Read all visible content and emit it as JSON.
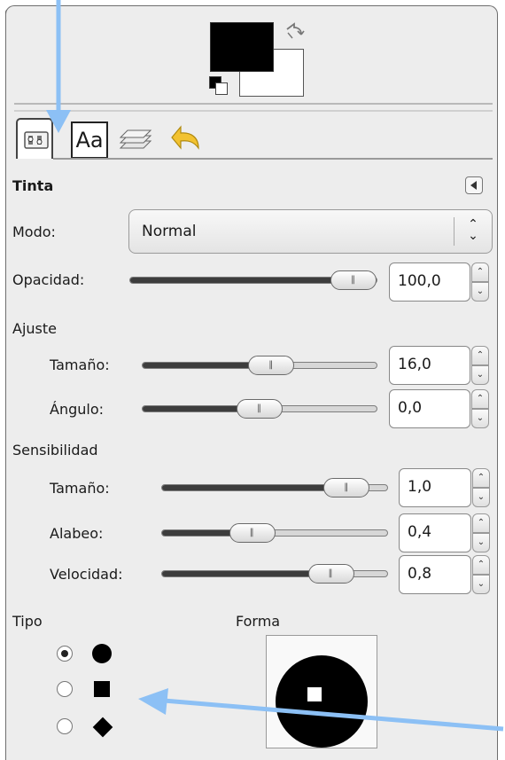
{
  "colors": {
    "accent_arrow": "#8cc0f5",
    "foreground": "#000000",
    "background": "#ffffff"
  },
  "tabs": [
    {
      "icon": "tool-options-icon"
    },
    {
      "label": "Aa"
    },
    {
      "icon": "layers-icon"
    },
    {
      "icon": "undo-history-icon"
    }
  ],
  "panel": {
    "title": "Tinta",
    "mode": {
      "label": "Modo:",
      "value": "Normal"
    },
    "opacity": {
      "label": "Opacidad:",
      "value": "100,0",
      "level": 1.0
    },
    "adjust": {
      "header": "Ajuste",
      "size": {
        "label": "Tamaño:",
        "value": "16,0",
        "level": 0.55
      },
      "angle": {
        "label": "Ángulo:",
        "value": "0,0",
        "level": 0.5
      }
    },
    "sensitivity": {
      "header": "Sensibilidad",
      "size": {
        "label": "Tamaño:",
        "value": "1,0",
        "level": 0.82
      },
      "tilt": {
        "label": "Alabeo:",
        "value": "0,4",
        "level": 0.4
      },
      "speed": {
        "label": "Velocidad:",
        "value": "0,8",
        "level": 0.75
      }
    },
    "type": {
      "header": "Tipo",
      "selected": "circle"
    },
    "shape": {
      "header": "Forma"
    }
  }
}
